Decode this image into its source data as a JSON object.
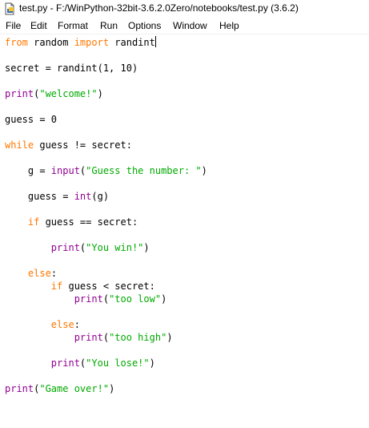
{
  "window": {
    "title": "test.py - F:/WinPython-32bit-3.6.2.0Zero/notebooks/test.py (3.6.2)"
  },
  "menu": {
    "items": [
      "File",
      "Edit",
      "Format",
      "Run",
      "Options",
      "Window",
      "Help"
    ]
  },
  "icons": {
    "app": "idle-document-icon"
  },
  "colors": {
    "keyword": "#ff7700",
    "builtin": "#900090",
    "string": "#00aa00",
    "text": "#000000"
  },
  "editor": {
    "lines": [
      {
        "tokens": [
          {
            "t": "kw",
            "s": "from"
          },
          {
            "t": "pl",
            "s": " random "
          },
          {
            "t": "kw",
            "s": "import"
          },
          {
            "t": "pl",
            "s": " randint"
          }
        ]
      },
      {
        "tokens": [
          {
            "t": "pl",
            "s": "secret = randint(1, 10)"
          }
        ]
      },
      {
        "tokens": [
          {
            "t": "bi",
            "s": "print"
          },
          {
            "t": "pl",
            "s": "("
          },
          {
            "t": "st",
            "s": "\"welcome!\""
          },
          {
            "t": "pl",
            "s": ")"
          }
        ]
      },
      {
        "tokens": [
          {
            "t": "pl",
            "s": "guess = 0"
          }
        ]
      },
      {
        "tokens": [
          {
            "t": "kw",
            "s": "while"
          },
          {
            "t": "pl",
            "s": " guess != secret:"
          }
        ]
      },
      {
        "tokens": [
          {
            "t": "pl",
            "s": "    g = "
          },
          {
            "t": "bi",
            "s": "input"
          },
          {
            "t": "pl",
            "s": "("
          },
          {
            "t": "st",
            "s": "\"Guess the number: \""
          },
          {
            "t": "pl",
            "s": ")"
          }
        ]
      },
      {
        "tokens": [
          {
            "t": "pl",
            "s": "    guess = "
          },
          {
            "t": "bi",
            "s": "int"
          },
          {
            "t": "pl",
            "s": "(g)"
          }
        ]
      },
      {
        "tokens": [
          {
            "t": "pl",
            "s": "    "
          },
          {
            "t": "kw",
            "s": "if"
          },
          {
            "t": "pl",
            "s": " guess == secret:"
          }
        ]
      },
      {
        "tokens": [
          {
            "t": "pl",
            "s": "        "
          },
          {
            "t": "bi",
            "s": "print"
          },
          {
            "t": "pl",
            "s": "("
          },
          {
            "t": "st",
            "s": "\"You win!\""
          },
          {
            "t": "pl",
            "s": ")"
          }
        ]
      },
      {
        "tokens": [
          {
            "t": "pl",
            "s": "    "
          },
          {
            "t": "kw",
            "s": "else"
          },
          {
            "t": "pl",
            "s": ":"
          }
        ]
      },
      {
        "tokens": [
          {
            "t": "pl",
            "s": "        "
          },
          {
            "t": "kw",
            "s": "if"
          },
          {
            "t": "pl",
            "s": " guess < secret:"
          }
        ]
      },
      {
        "tokens": [
          {
            "t": "pl",
            "s": "            "
          },
          {
            "t": "bi",
            "s": "print"
          },
          {
            "t": "pl",
            "s": "("
          },
          {
            "t": "st",
            "s": "\"too low\""
          },
          {
            "t": "pl",
            "s": ")"
          }
        ]
      },
      {
        "tokens": [
          {
            "t": "pl",
            "s": "        "
          },
          {
            "t": "kw",
            "s": "else"
          },
          {
            "t": "pl",
            "s": ":"
          }
        ]
      },
      {
        "tokens": [
          {
            "t": "pl",
            "s": "            "
          },
          {
            "t": "bi",
            "s": "print"
          },
          {
            "t": "pl",
            "s": "("
          },
          {
            "t": "st",
            "s": "\"too high\""
          },
          {
            "t": "pl",
            "s": ")"
          }
        ]
      },
      {
        "tokens": [
          {
            "t": "pl",
            "s": "        "
          },
          {
            "t": "bi",
            "s": "print"
          },
          {
            "t": "pl",
            "s": "("
          },
          {
            "t": "st",
            "s": "\"You lose!\""
          },
          {
            "t": "pl",
            "s": ")"
          }
        ]
      },
      {
        "tokens": [
          {
            "t": "bi",
            "s": "print"
          },
          {
            "t": "pl",
            "s": "("
          },
          {
            "t": "st",
            "s": "\"Game over!\""
          },
          {
            "t": "pl",
            "s": ")"
          }
        ]
      }
    ]
  }
}
